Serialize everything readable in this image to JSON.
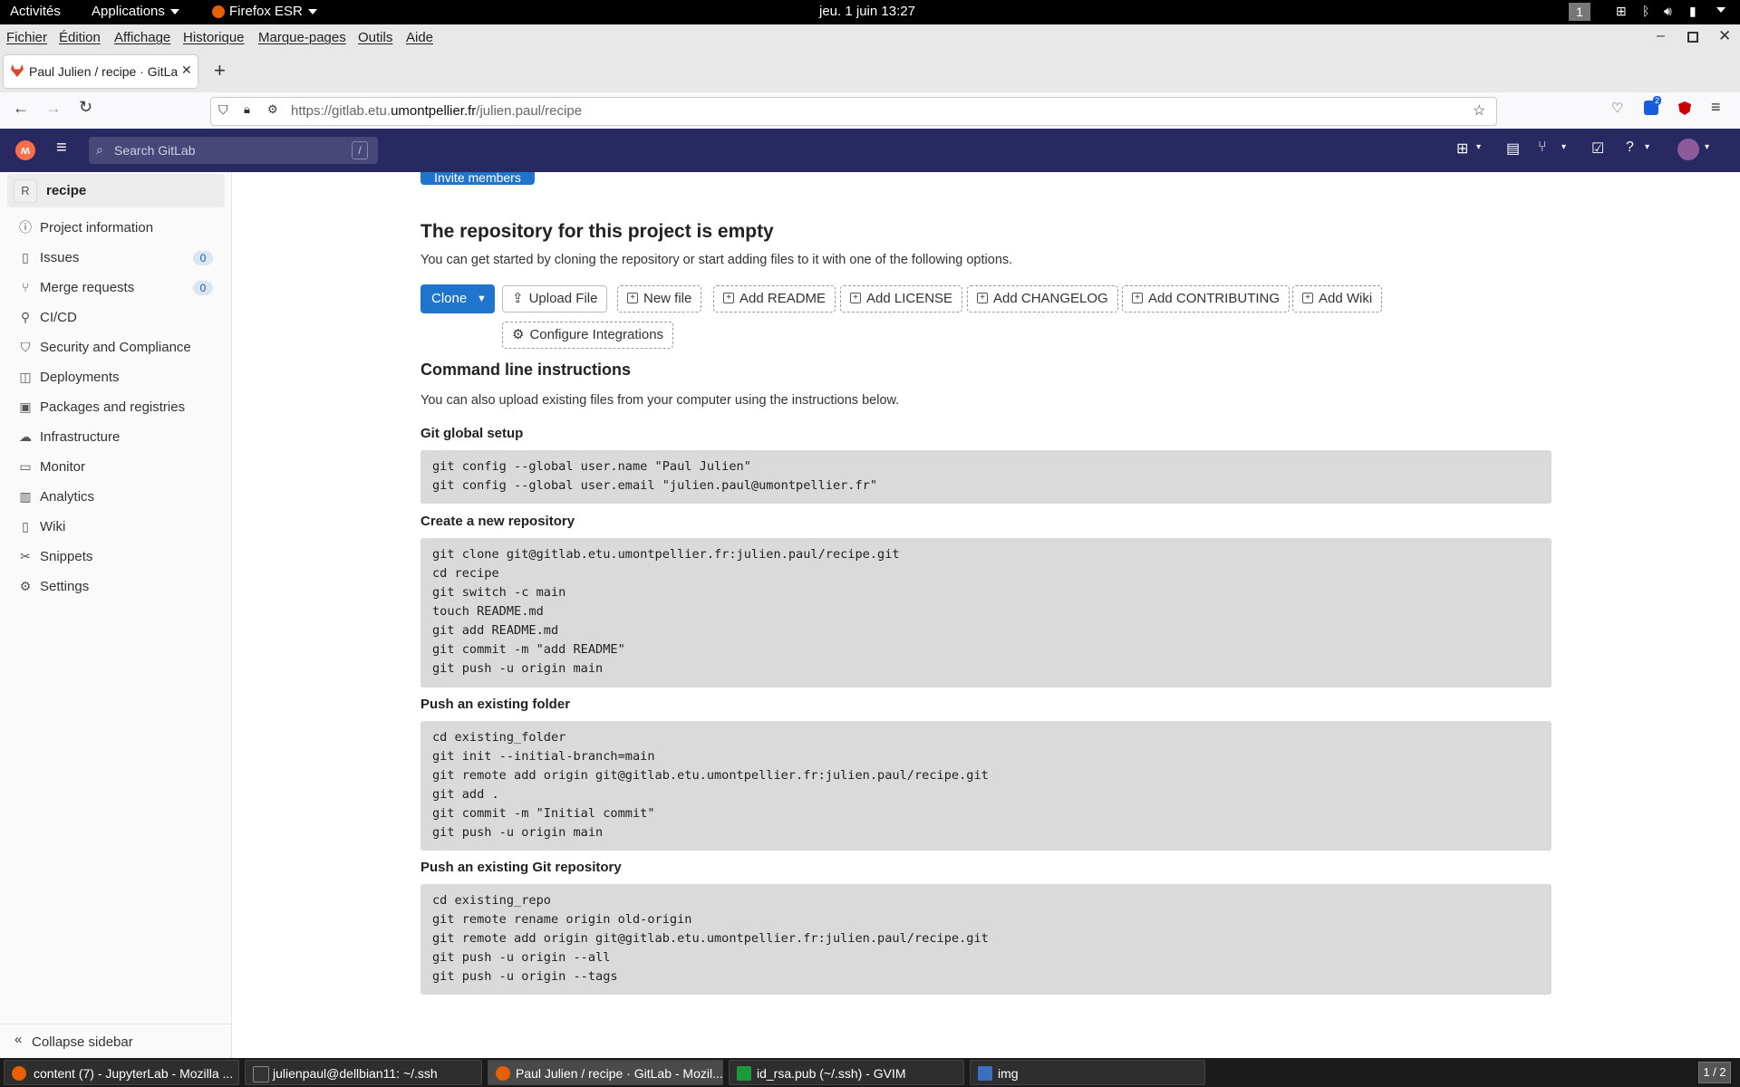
{
  "gnome": {
    "activities": "Activités",
    "applications": "Applications",
    "firefox": "Firefox ESR",
    "clock": "jeu. 1 juin  13:27",
    "workspace": "1"
  },
  "firefox_menu": [
    "Fichier",
    "Édition",
    "Affichage",
    "Historique",
    "Marque-pages",
    "Outils",
    "Aide"
  ],
  "tab": {
    "title": "Paul Julien / recipe · GitLa",
    "new_tab": "+"
  },
  "url": {
    "prefix": "https://gitlab.etu.",
    "domain": "umontpellier.fr",
    "path": "/julien.paul/recipe"
  },
  "toolbar_badge": "2",
  "gitlab": {
    "search_placeholder": "Search GitLab",
    "search_shortcut": "/"
  },
  "sidebar": {
    "project_initial": "R",
    "project_name": "recipe",
    "items": [
      {
        "label": "Project information",
        "icon": "info-icon"
      },
      {
        "label": "Issues",
        "icon": "issues-icon",
        "count": "0"
      },
      {
        "label": "Merge requests",
        "icon": "merge-request-icon",
        "count": "0"
      },
      {
        "label": "CI/CD",
        "icon": "rocket-icon"
      },
      {
        "label": "Security and Compliance",
        "icon": "shield-icon"
      },
      {
        "label": "Deployments",
        "icon": "deployments-icon"
      },
      {
        "label": "Packages and registries",
        "icon": "package-icon"
      },
      {
        "label": "Infrastructure",
        "icon": "cloud-icon"
      },
      {
        "label": "Monitor",
        "icon": "monitor-icon"
      },
      {
        "label": "Analytics",
        "icon": "chart-icon"
      },
      {
        "label": "Wiki",
        "icon": "book-icon"
      },
      {
        "label": "Snippets",
        "icon": "snippet-icon"
      },
      {
        "label": "Settings",
        "icon": "gear-icon"
      }
    ],
    "collapse": "Collapse sidebar"
  },
  "main": {
    "invite_button": "Invite members",
    "empty_title": "The repository for this project is empty",
    "empty_desc": "You can get started by cloning the repository or start adding files to it with one of the following options.",
    "clone": "Clone",
    "actions": [
      "Upload File",
      "New file",
      "Add README",
      "Add LICENSE",
      "Add CHANGELOG",
      "Add CONTRIBUTING",
      "Add Wiki"
    ],
    "configure": "Configure Integrations",
    "cli_title": "Command line instructions",
    "cli_desc": "You can also upload existing files from your computer using the instructions below.",
    "sections": [
      {
        "title": "Git global setup",
        "code": "git config --global user.name \"Paul Julien\"\ngit config --global user.email \"julien.paul@umontpellier.fr\""
      },
      {
        "title": "Create a new repository",
        "code": "git clone git@gitlab.etu.umontpellier.fr:julien.paul/recipe.git\ncd recipe\ngit switch -c main\ntouch README.md\ngit add README.md\ngit commit -m \"add README\"\ngit push -u origin main"
      },
      {
        "title": "Push an existing folder",
        "code": "cd existing_folder\ngit init --initial-branch=main\ngit remote add origin git@gitlab.etu.umontpellier.fr:julien.paul/recipe.git\ngit add .\ngit commit -m \"Initial commit\"\ngit push -u origin main"
      },
      {
        "title": "Push an existing Git repository",
        "code": "cd existing_repo\ngit remote rename origin old-origin\ngit remote add origin git@gitlab.etu.umontpellier.fr:julien.paul/recipe.git\ngit push -u origin --all\ngit push -u origin --tags"
      }
    ]
  },
  "taskbar": {
    "tasks": [
      "content (7) - JupyterLab - Mozilla ...",
      "julienpaul@dellbian11: ~/.ssh",
      "Paul Julien / recipe · GitLab - Mozil...",
      "id_rsa.pub (~/.ssh) - GVIM",
      "img"
    ],
    "pager": "1 / 2"
  },
  "colors": {
    "gitlab_header": "#292961",
    "primary_button": "#1f75cb",
    "badge": "#dbe6f3"
  }
}
